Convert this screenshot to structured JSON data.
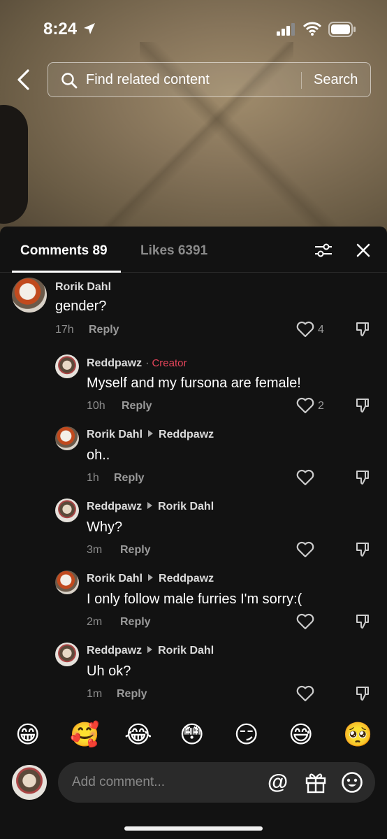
{
  "status_bar": {
    "time": "8:24"
  },
  "search": {
    "placeholder": "Find related content",
    "button_label": "Search"
  },
  "tabs": {
    "comments_label": "Comments 89",
    "likes_label": "Likes 6391"
  },
  "comments": [
    {
      "author": "Rorik Dahl",
      "text": "gender?",
      "time": "17h",
      "reply_label": "Reply",
      "likes": "4"
    },
    {
      "author": "Reddpawz",
      "creator_dot": "·",
      "creator_tag": "Creator",
      "text": "Myself and my fursona are female!",
      "time": "10h",
      "reply_label": "Reply",
      "likes": "2"
    },
    {
      "author": "Rorik Dahl",
      "reply_to": "Reddpawz",
      "text": "oh..",
      "time": "1h",
      "reply_label": "Reply"
    },
    {
      "author": "Reddpawz",
      "reply_to": "Rorik Dahl",
      "text": "Why?",
      "time": "3m",
      "reply_label": "Reply"
    },
    {
      "author": "Rorik Dahl",
      "reply_to": "Reddpawz",
      "text": "I only follow male furries I'm sorry:(",
      "time": "2m",
      "reply_label": "Reply"
    },
    {
      "author": "Reddpawz",
      "reply_to": "Rorik Dahl",
      "text": "Uh ok?",
      "time": "1m",
      "reply_label": "Reply"
    }
  ],
  "emoji_bar": [
    "😁",
    "🥰",
    "😂",
    "😳",
    "😏",
    "😅",
    "🥺"
  ],
  "composer": {
    "placeholder": "Add comment...",
    "at_label": "@"
  },
  "icons": {
    "back": "chevron-left-icon",
    "search": "search-icon",
    "filter": "sliders-icon",
    "close": "close-icon",
    "like": "heart-icon",
    "dislike": "thumbs-down-icon",
    "gift": "gift-icon",
    "emoji": "smiley-icon"
  },
  "colors": {
    "creator_tag": "#e8455b",
    "panel_bg": "#121212"
  }
}
